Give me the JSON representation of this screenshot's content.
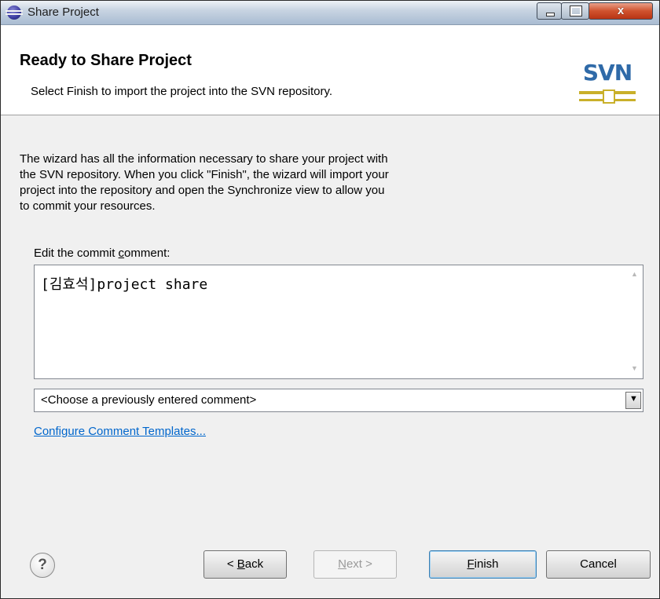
{
  "window": {
    "title": "Share Project",
    "controls": {
      "minimize": "minimize",
      "maximize": "maximize",
      "close": "x"
    }
  },
  "header": {
    "title": "Ready to Share Project",
    "description": "Select Finish to import the project into the SVN repository.",
    "logo_text": "SVN"
  },
  "body": {
    "intro_lines": [
      "The wizard has all the information necessary to share your project with",
      "the SVN repository. When you click \"Finish\", the wizard will import your",
      "project into the repository and open the Synchronize view to allow you",
      "to commit your resources."
    ],
    "comment_label_pre": "Edit the commit ",
    "comment_label_mnemonic": "c",
    "comment_label_post": "omment:",
    "comment_value": "[김효석]project share",
    "previous_comment_placeholder": "<Choose a previously entered comment>",
    "configure_link": "Configure Comment Templates..."
  },
  "buttons": {
    "back_prefix": "< ",
    "back_mnemonic": "B",
    "back_rest": "ack",
    "next_mnemonic": "N",
    "next_rest": "ext >",
    "finish_mnemonic": "F",
    "finish_rest": "inish",
    "cancel": "Cancel",
    "help": "?"
  },
  "colors": {
    "link": "#0066cc",
    "svn_blue": "#2f6aa8",
    "svn_gold": "#c9b02a",
    "close_red": "#d0522e"
  }
}
